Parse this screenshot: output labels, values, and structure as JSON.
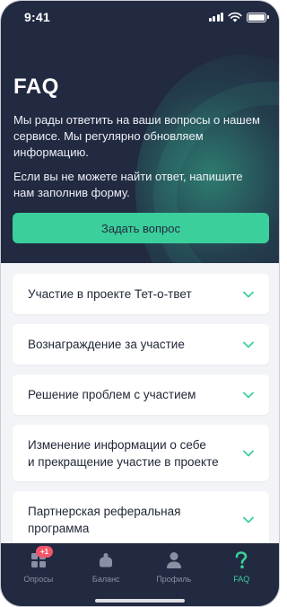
{
  "status_bar": {
    "time": "9:41"
  },
  "header": {
    "title": "FAQ",
    "intro_1": "Мы рады ответить на ваши вопросы о нашем сервисе. Мы регулярно обновляем информацию.",
    "intro_2": "Если вы не можете найти ответ, напишите нам заполнив форму.",
    "ask_button": "Задать вопрос"
  },
  "faq": {
    "items": [
      {
        "label": "Участие в проекте Тет-о-твет"
      },
      {
        "label": "Вознаграждение за участие"
      },
      {
        "label": "Решение проблем с участием"
      },
      {
        "label": "Изменение информации о себе\nи прекращение участие в проекте"
      },
      {
        "label": "Партнерская реферальная\nпрограмма"
      }
    ]
  },
  "nav": {
    "items": [
      {
        "label": "Опросы",
        "icon": "grid-icon",
        "badge": "+1"
      },
      {
        "label": "Баланс",
        "icon": "piggy-bank-icon"
      },
      {
        "label": "Профиль",
        "icon": "user-icon"
      },
      {
        "label": "FAQ",
        "icon": "question-icon",
        "active": true
      }
    ]
  },
  "colors": {
    "header_bg": "#222a42",
    "accent": "#3bcf9c",
    "badge": "#f0566a",
    "page_bg": "#f3f4f7"
  }
}
